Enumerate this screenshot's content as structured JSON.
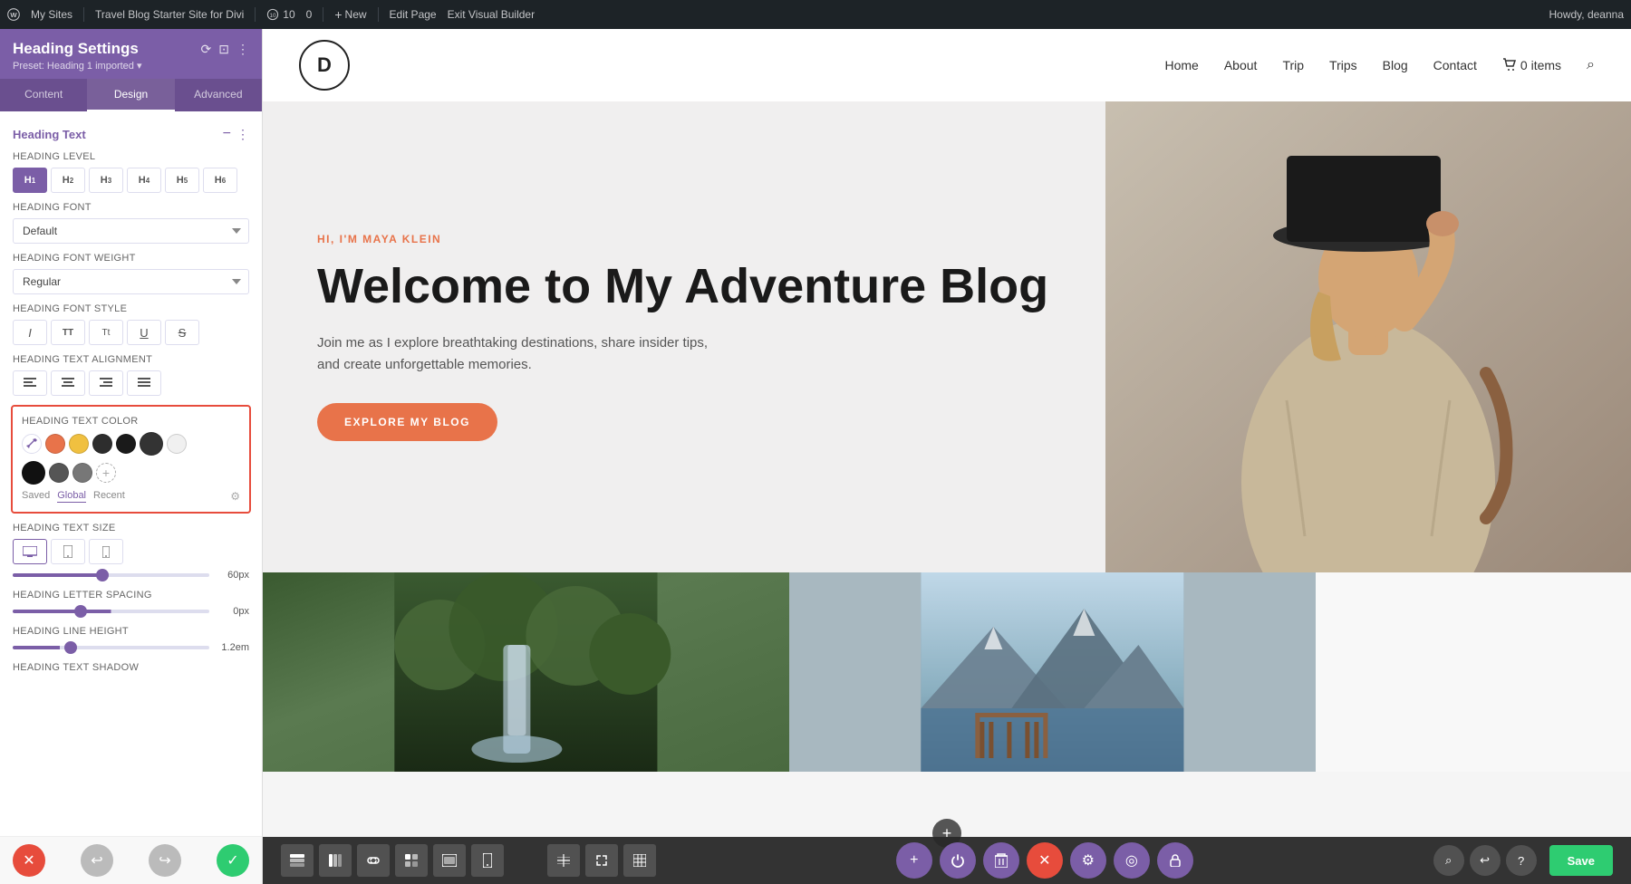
{
  "admin_bar": {
    "wp_icon": "wordpress-icon",
    "my_sites_label": "My Sites",
    "blog_name": "Travel Blog Starter Site for Divi",
    "updates_count": "10",
    "comments_count": "0",
    "new_label": "New",
    "edit_page_label": "Edit Page",
    "exit_builder_label": "Exit Visual Builder",
    "howdy_label": "Howdy, deanna"
  },
  "panel": {
    "title": "Heading Settings",
    "preset": "Preset: Heading 1 imported ▾",
    "tabs": [
      "Content",
      "Design",
      "Advanced"
    ],
    "active_tab": "Design",
    "section_title": "Heading Text",
    "heading_level_label": "Heading Level",
    "heading_levels": [
      "H1",
      "H2",
      "H3",
      "H4",
      "H5",
      "H6"
    ],
    "active_heading_level": "H1",
    "heading_font_label": "Heading Font",
    "heading_font_value": "Default",
    "heading_font_weight_label": "Heading Font Weight",
    "heading_font_weight_value": "Regular",
    "heading_font_style_label": "Heading Font Style",
    "heading_font_styles": [
      "I",
      "TT",
      "T̶",
      "U",
      "S"
    ],
    "heading_text_alignment_label": "Heading Text Alignment",
    "heading_text_color_label": "Heading Text Color",
    "color_swatches": [
      {
        "id": "eyedropper",
        "color": "eyedropper"
      },
      {
        "id": "orange",
        "color": "#e8734a"
      },
      {
        "id": "yellow",
        "color": "#f0c040"
      },
      {
        "id": "dark1",
        "color": "#2d2d2d"
      },
      {
        "id": "dark2",
        "color": "#1a1a1a"
      },
      {
        "id": "dark3",
        "color": "#333333"
      },
      {
        "id": "light",
        "color": "#f5f5f5"
      },
      {
        "id": "black1",
        "color": "#000000"
      },
      {
        "id": "darkgray",
        "color": "#444444"
      },
      {
        "id": "medgray",
        "color": "#888888"
      },
      {
        "id": "add",
        "color": "add"
      }
    ],
    "color_tabs": [
      "Saved",
      "Global",
      "Recent"
    ],
    "active_color_tab": "Global",
    "heading_text_size_label": "Heading Text Size",
    "heading_text_size_value": "60px",
    "heading_letter_spacing_label": "Heading Letter Spacing",
    "heading_letter_spacing_value": "0px",
    "heading_line_height_label": "Heading Line Height",
    "heading_line_height_value": "1.2em",
    "heading_text_shadow_label": "Heading Text Shadow"
  },
  "site_header": {
    "logo_text": "D",
    "nav_items": [
      "Home",
      "About",
      "Trip",
      "Trips",
      "Blog",
      "Contact"
    ],
    "cart_label": "0 items"
  },
  "hero": {
    "subtitle": "HI, I'M MAYA KLEIN",
    "title": "Welcome to My Adventure Blog",
    "description": "Join me as I explore breathtaking destinations, share insider tips, and create unforgettable memories.",
    "cta_label": "EXPLORE MY BLOG"
  },
  "bottom_toolbar": {
    "left_buttons": [
      "rows",
      "columns",
      "link",
      "module",
      "section",
      "mobile"
    ],
    "center_buttons": [
      "add",
      "power",
      "trash",
      "close",
      "settings",
      "history",
      "lock"
    ],
    "right_buttons": [
      "search",
      "history2",
      "help"
    ],
    "save_label": "Save"
  }
}
